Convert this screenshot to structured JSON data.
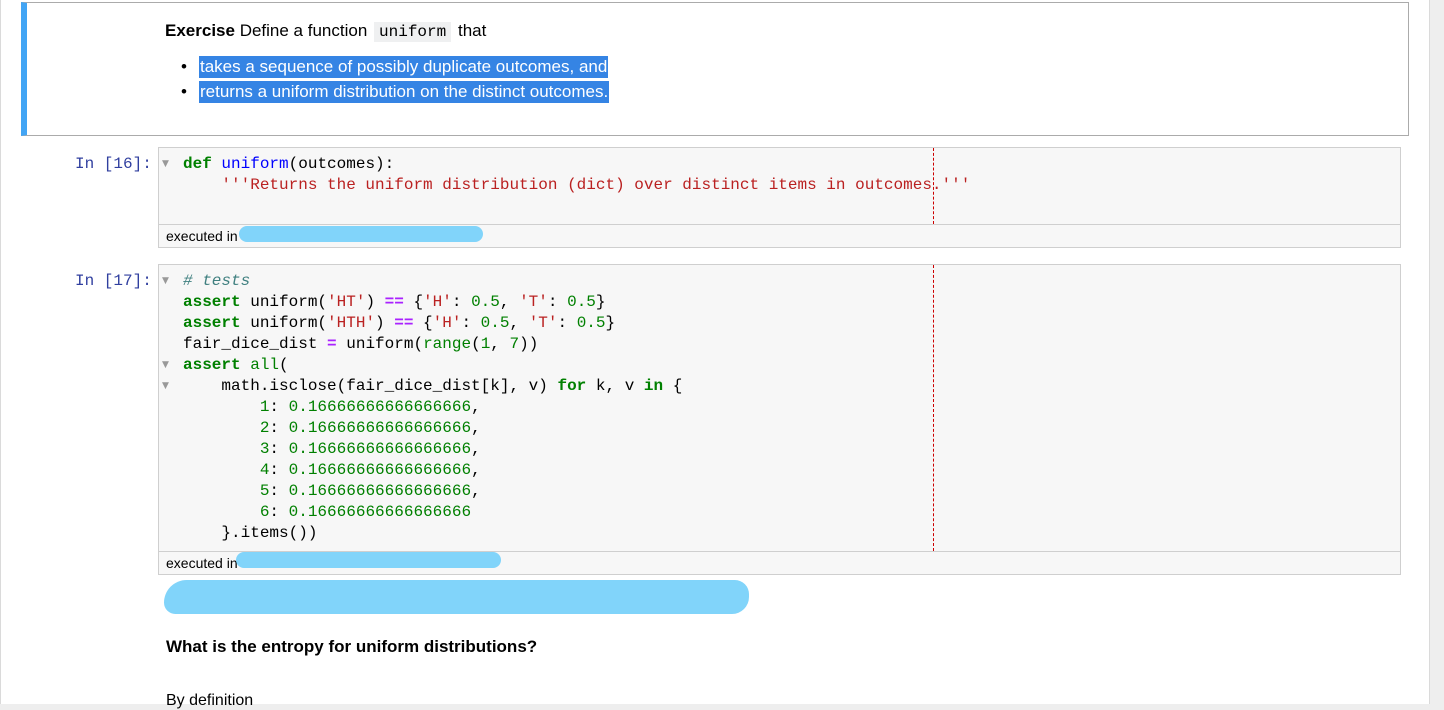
{
  "exercise": {
    "label": "Exercise",
    "text_before": "Define a function",
    "code": "uniform",
    "text_after": "that",
    "bullets": [
      "takes a sequence of possibly duplicate outcomes, and",
      "returns a uniform distribution on the distinct outcomes."
    ]
  },
  "cell16": {
    "prompt": "In [16]:",
    "status": "executed in"
  },
  "cell17": {
    "prompt": "In [17]:",
    "status": "executed in"
  },
  "question": "What is the entropy for uniform distributions?",
  "definition": "By definition"
}
